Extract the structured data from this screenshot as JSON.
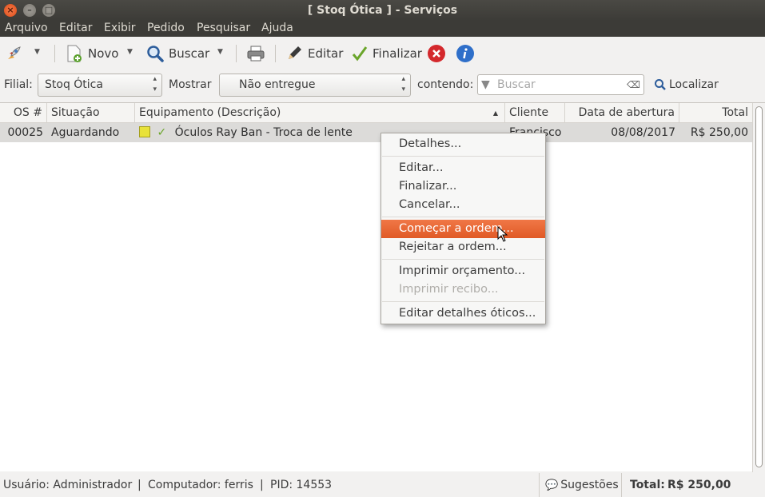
{
  "window": {
    "title": "[ Stoq Ótica ] - Serviços"
  },
  "menubar": {
    "items": [
      "Arquivo",
      "Editar",
      "Exibir",
      "Pedido",
      "Pesquisar",
      "Ajuda"
    ]
  },
  "toolbar": {
    "new_label": "Novo",
    "search_label": "Buscar",
    "edit_label": "Editar",
    "finish_label": "Finalizar"
  },
  "filters": {
    "branch_label": "Filial:",
    "branch_value": "Stoq Ótica",
    "show_label": "Mostrar",
    "show_value": "Não entregue",
    "containing_label": "contendo:",
    "search_placeholder": "Buscar",
    "locate_label": "Localizar"
  },
  "table": {
    "columns": [
      "OS #",
      "Situação",
      "Equipamento (Descrição)",
      "Cliente",
      "Data de abertura",
      "Total"
    ],
    "rows": [
      {
        "os": "00025",
        "status": "Aguardando",
        "equipment": "Óculos Ray Ban  - Troca de lente",
        "client": "Francisco El",
        "opened": "08/08/2017",
        "total": "R$ 250,00"
      }
    ]
  },
  "context_menu": {
    "items": [
      {
        "label": "Detalhes...",
        "state": "normal"
      },
      {
        "label": "Editar...",
        "state": "normal"
      },
      {
        "label": "Finalizar...",
        "state": "normal"
      },
      {
        "label": "Cancelar...",
        "state": "normal"
      },
      {
        "label": "Começar a ordem...",
        "state": "highlighted"
      },
      {
        "label": "Rejeitar a ordem...",
        "state": "normal"
      },
      {
        "label": "Imprimir orçamento...",
        "state": "normal"
      },
      {
        "label": "Imprimir recibo...",
        "state": "disabled"
      },
      {
        "label": "Editar detalhes óticos...",
        "state": "normal"
      }
    ]
  },
  "statusbar": {
    "user": "Usuário: Administrador",
    "computer": "Computador: ferris",
    "pid": "PID: 14553",
    "suggestions": "Sugestões",
    "total_label": "Total:",
    "total_value": "R$ 250,00"
  },
  "colors": {
    "accent": "#e9622f",
    "titlebar": "#3c3b37",
    "selection_row": "#dcdbd9"
  }
}
